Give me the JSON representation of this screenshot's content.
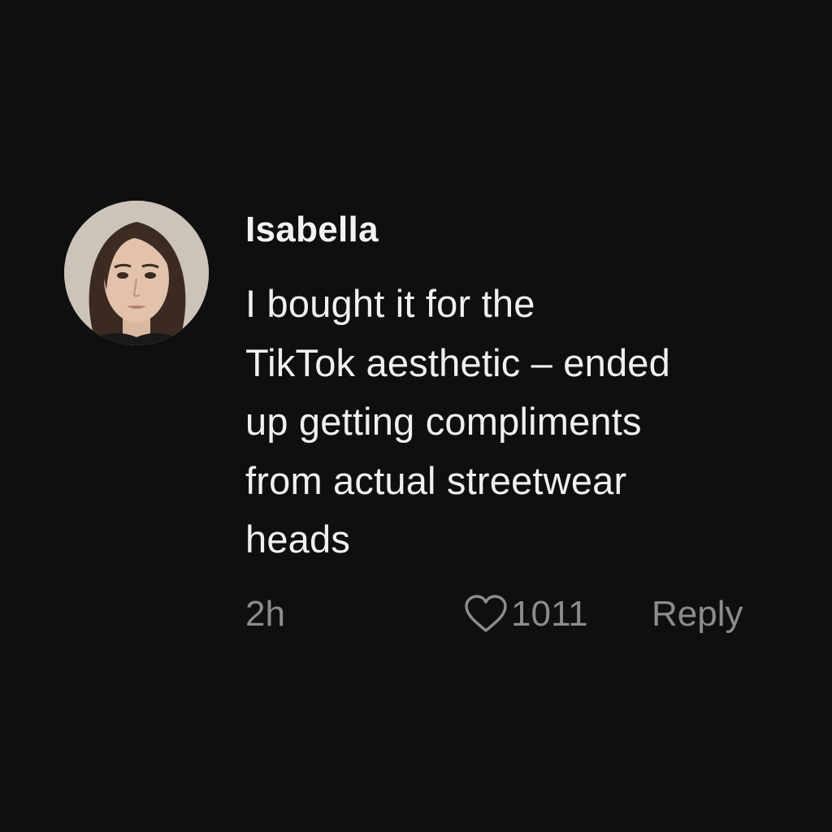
{
  "comment": {
    "username": "Isabella",
    "text": "I bought it for the\nTikTok aesthetic – ended\nup getting compliments\nfrom actual streetwear\nheads",
    "timestamp": "2h",
    "like_count": "1011",
    "reply_label": "Reply",
    "avatar_icon": "avatar-photo",
    "like_icon": "heart-outline-icon"
  },
  "colors": {
    "background": "#0f0f0f",
    "primary_text": "#f0f0f0",
    "secondary_text": "#8c8c8c"
  }
}
